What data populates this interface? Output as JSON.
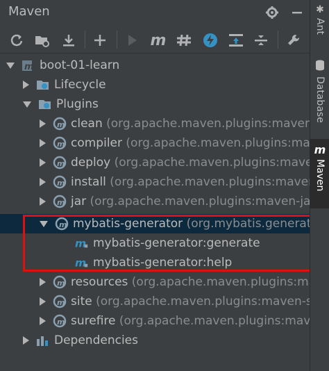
{
  "panel": {
    "title": "Maven"
  },
  "tree": {
    "root": "boot-01-learn",
    "lifecycle": "Lifecycle",
    "plugins": "Plugins",
    "plugin_rows": [
      {
        "name": "clean",
        "detail": "(org.apache.maven.plugins:maven-c"
      },
      {
        "name": "compiler",
        "detail": "(org.apache.maven.plugins:mave"
      },
      {
        "name": "deploy",
        "detail": "(org.apache.maven.plugins:mave"
      },
      {
        "name": "install",
        "detail": "(org.apache.maven.plugins:maven-"
      },
      {
        "name": "jar",
        "detail": "(org.apache.maven.plugins:maven-jar-"
      },
      {
        "name": "mybatis-generator",
        "detail": "(org.mybatis.generato"
      },
      {
        "name": "resources",
        "detail": "(org.apache.maven.plugins:mave"
      },
      {
        "name": "site",
        "detail": "(org.apache.maven.plugins:maven-sit"
      },
      {
        "name": "surefire",
        "detail": "(org.apache.maven.plugins:mave"
      }
    ],
    "goals": [
      "mybatis-generator:generate",
      "mybatis-generator:help"
    ],
    "dependencies": "Dependencies"
  },
  "sidebar": {
    "ant": "Ant",
    "database": "Database",
    "maven": "Maven"
  },
  "colors": {
    "background": "#3c3f41",
    "selection": "#0d293e",
    "highlight_box": "#e01010",
    "accent_blue": "#3592c4"
  }
}
